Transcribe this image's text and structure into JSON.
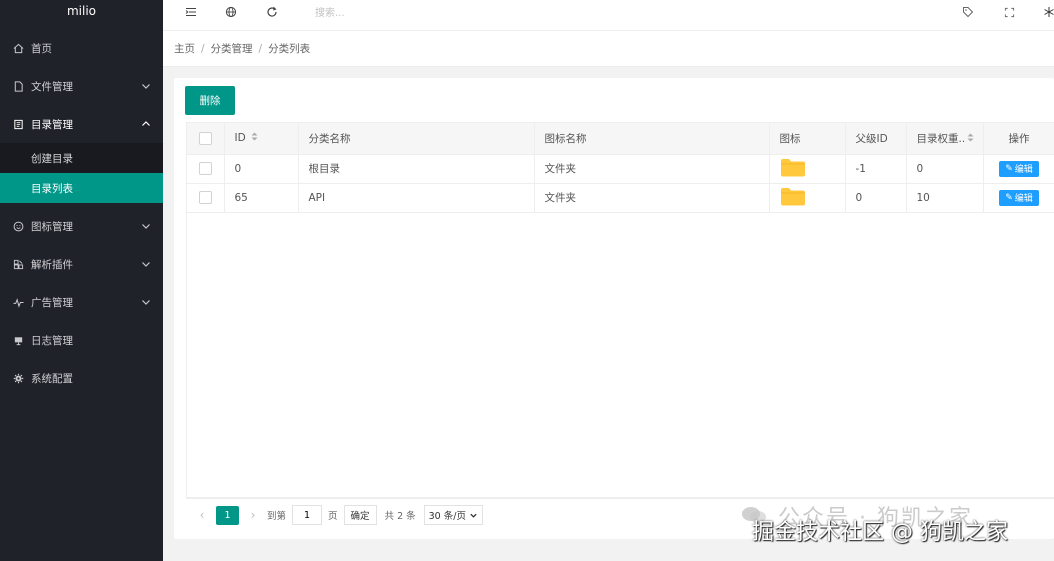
{
  "app": {
    "logo": "milio"
  },
  "sidebar": {
    "items": [
      {
        "label": "首页",
        "icon": "home-icon"
      },
      {
        "label": "文件管理",
        "icon": "file-icon"
      },
      {
        "label": "目录管理",
        "icon": "folder-icon"
      },
      {
        "label": "图标管理",
        "icon": "smiley-icon"
      },
      {
        "label": "解析插件",
        "icon": "plugin-icon"
      },
      {
        "label": "广告管理",
        "icon": "pulse-icon"
      },
      {
        "label": "日志管理",
        "icon": "log-icon"
      },
      {
        "label": "系统配置",
        "icon": "gear-icon"
      }
    ],
    "submenu": [
      {
        "label": "创建目录"
      },
      {
        "label": "目录列表"
      }
    ]
  },
  "topbar": {
    "search_placeholder": "搜索..."
  },
  "breadcrumb": {
    "items": [
      "主页",
      "分类管理",
      "分类列表"
    ]
  },
  "toolbar": {
    "delete_label": "删除"
  },
  "table": {
    "headers": [
      "ID",
      "分类名称",
      "图标名称",
      "图标",
      "父级ID",
      "目录权重..",
      "操作"
    ],
    "rows": [
      {
        "id": "0",
        "name": "根目录",
        "icon_name": "文件夹",
        "parent_id": "-1",
        "weight": "0",
        "edit": "编辑"
      },
      {
        "id": "65",
        "name": "API",
        "icon_name": "文件夹",
        "parent_id": "0",
        "weight": "10",
        "edit": "编辑"
      }
    ]
  },
  "pagination": {
    "current": "1",
    "goto_label": "到第",
    "goto_value": "1",
    "page_label": "页",
    "confirm_label": "确定",
    "total_label": "共 2 条",
    "page_size": "30 条/页"
  },
  "watermark": {
    "line1": "公众号 · 狗凯之家",
    "line2": "掘金技术社区 @ 狗凯之家"
  },
  "colors": {
    "accent": "#009688",
    "sidebar_bg": "#20222a",
    "edit_button": "#1e9fff",
    "folder": "#ffc83d"
  }
}
